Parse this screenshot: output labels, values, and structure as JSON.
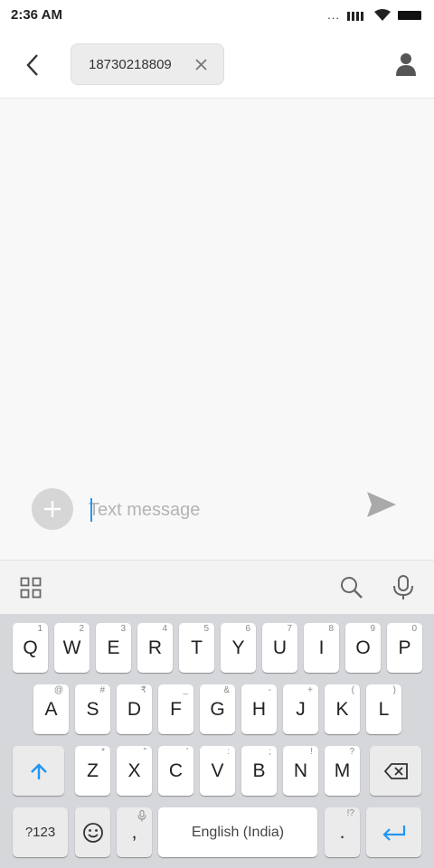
{
  "status": {
    "time": "2:36 AM",
    "dots": "..."
  },
  "header": {
    "recipient": "18730218809"
  },
  "composer": {
    "placeholder": "Text message"
  },
  "keyboard": {
    "row1": [
      {
        "label": "Q",
        "hint": "1"
      },
      {
        "label": "W",
        "hint": "2"
      },
      {
        "label": "E",
        "hint": "3"
      },
      {
        "label": "R",
        "hint": "4"
      },
      {
        "label": "T",
        "hint": "5"
      },
      {
        "label": "Y",
        "hint": "6"
      },
      {
        "label": "U",
        "hint": "7"
      },
      {
        "label": "I",
        "hint": "8"
      },
      {
        "label": "O",
        "hint": "9"
      },
      {
        "label": "P",
        "hint": "0"
      }
    ],
    "row2": [
      {
        "label": "A",
        "hint": "@"
      },
      {
        "label": "S",
        "hint": "#"
      },
      {
        "label": "D",
        "hint": "₹"
      },
      {
        "label": "F",
        "hint": "_"
      },
      {
        "label": "G",
        "hint": "&"
      },
      {
        "label": "H",
        "hint": "-"
      },
      {
        "label": "J",
        "hint": "+"
      },
      {
        "label": "K",
        "hint": "("
      },
      {
        "label": "L",
        "hint": ")"
      }
    ],
    "row3": [
      {
        "label": "Z",
        "hint": "*"
      },
      {
        "label": "X",
        "hint": "\""
      },
      {
        "label": "C",
        "hint": "'"
      },
      {
        "label": "V",
        "hint": ":"
      },
      {
        "label": "B",
        "hint": ";"
      },
      {
        "label": "N",
        "hint": "!"
      },
      {
        "label": "M",
        "hint": "?"
      }
    ],
    "symbols_label": "?123",
    "comma_label": ",",
    "space_label": "English (India)",
    "period_label": ".",
    "period_hint": "!?"
  },
  "colors": {
    "accent": "#2196f3",
    "keyboard_bg": "#d5d7da"
  },
  "icons": [
    "back-arrow-icon",
    "close-icon",
    "contact-person-icon",
    "plus-icon",
    "send-icon",
    "apps-grid-icon",
    "search-icon",
    "microphone-icon",
    "shift-arrow-icon",
    "backspace-icon",
    "emoji-icon",
    "enter-icon",
    "signal-icon",
    "wifi-icon",
    "battery-icon"
  ]
}
